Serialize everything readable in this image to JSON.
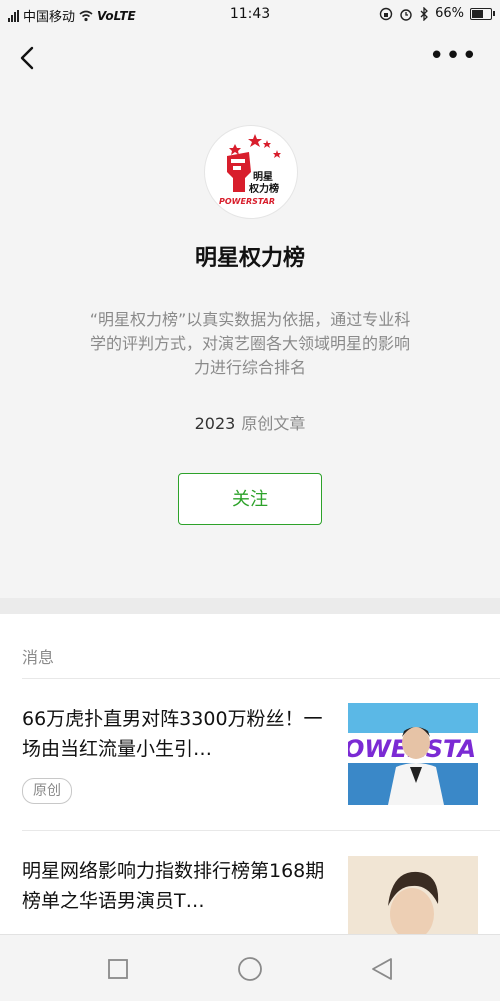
{
  "status": {
    "carrier": "中国移动",
    "network": "VoLTE",
    "time": "11:43",
    "battery": "66%",
    "battery_level": 0.66
  },
  "profile": {
    "name": "明星权力榜",
    "avatar_logo_text": "明星权力榜 POWERSTAR",
    "description": "“明星权力榜”以真实数据为依据，通过专业科学的评判方式，对演艺圈各大领域明星的影响力进行综合排名",
    "article_count": "2023",
    "article_label": "原创文章",
    "follow_label": "关注"
  },
  "messages": {
    "section_title": "消息",
    "items": [
      {
        "title": "66万虎扑直男对阵3300万粉丝！一场由当红流量小生引…",
        "tag": "原创",
        "thumb_text": "OWERSTA"
      },
      {
        "title": "明星网络影响力指数排行榜第168期榜单之华语男演员T…",
        "tag": ""
      }
    ]
  },
  "colors": {
    "accent": "#2da22a",
    "brand_red": "#d81e2c",
    "brand_purple": "#7b2ad4"
  },
  "icons": [
    "signal-icon",
    "wifi-icon",
    "alarm-icon",
    "bluetooth-icon",
    "battery-icon",
    "back-arrow-icon",
    "more-icon",
    "square-nav-icon",
    "circle-nav-icon",
    "triangle-nav-icon"
  ]
}
